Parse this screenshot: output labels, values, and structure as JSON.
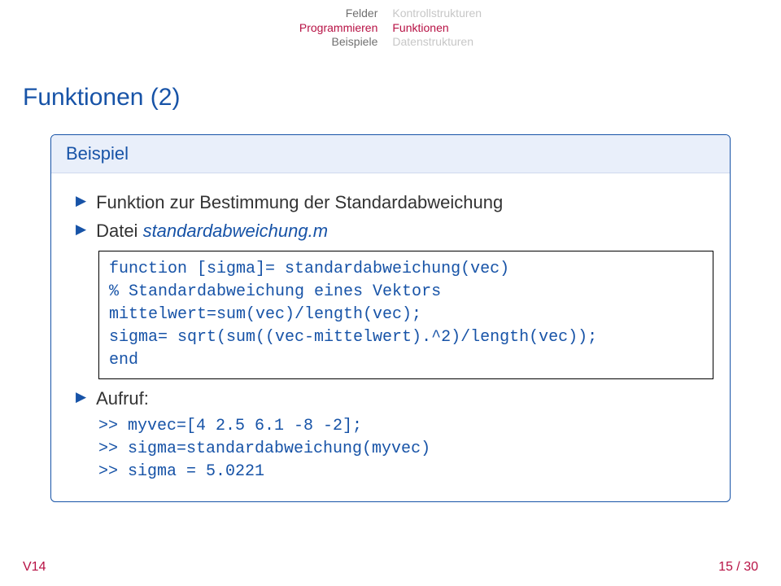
{
  "nav": {
    "left": [
      "Felder",
      "Programmieren",
      "Beispiele"
    ],
    "left_active_index": 1,
    "right": [
      "Kontrollstrukturen",
      "Funktionen",
      "Datenstrukturen"
    ],
    "right_active_index": 1
  },
  "title": "Funktionen (2)",
  "block": {
    "title": "Beispiel",
    "bullet1": "Funktion zur Bestimmung der Standardabweichung",
    "bullet2_prefix": "Datei ",
    "bullet2_file": "standardabweichung.m",
    "code": "function [sigma]= standardabweichung(vec)\n% Standardabweichung eines Vektors\nmittelwert=sum(vec)/length(vec);\nsigma= sqrt(sum((vec-mittelwert).^2)/length(vec));\nend",
    "bullet3": "Aufruf:",
    "call": ">> myvec=[4 2.5 6.1 -8 -2];\n>> sigma=standardabweichung(myvec)\n>> sigma = 5.0221"
  },
  "footer": {
    "left": "V14",
    "right": "15 / 30"
  }
}
